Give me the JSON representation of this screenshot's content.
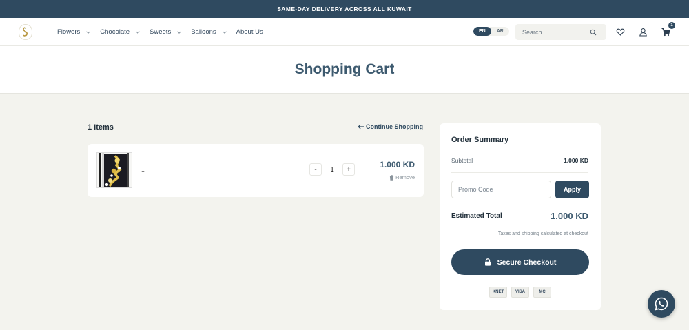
{
  "announcement": "SAME-DAY DELIVERY ACROSS ALL KUWAIT",
  "nav": {
    "menu": [
      {
        "label": "Flowers",
        "has_dropdown": true
      },
      {
        "label": "Chocolate",
        "has_dropdown": true
      },
      {
        "label": "Sweets",
        "has_dropdown": true
      },
      {
        "label": "Balloons",
        "has_dropdown": true
      },
      {
        "label": "About Us",
        "has_dropdown": false
      }
    ],
    "lang_active": "EN",
    "lang_other": "AR",
    "search_placeholder": "Search...",
    "icons": [
      "search-icon",
      "heart-icon",
      "user-icon",
      "cart-icon"
    ],
    "cart_count": "1"
  },
  "page_title": "Shopping Cart",
  "cart": {
    "items_count": "1 Items",
    "continue_label": "Continue Shopping",
    "items": [
      {
        "name": "..",
        "quantity": "1",
        "price": "1.000 KD",
        "remove_label": "Remove"
      }
    ]
  },
  "summary": {
    "title": "Order Summary",
    "subtotal_label": "Subtotal",
    "subtotal_value": "1.000 KD",
    "promo_placeholder": "Promo Code",
    "apply_label": "Apply",
    "estimated_label": "Estimated Total",
    "estimated_value": "1.000 KD",
    "tax_note": "Taxes and shipping calculated at checkout",
    "checkout_label": "Secure Checkout",
    "payment_methods": [
      "KNET",
      "VISA",
      "MC"
    ]
  },
  "colors": {
    "primary": "#2f4a60",
    "accent_text": "#3d5a6f",
    "background": "#f3f3ee"
  }
}
